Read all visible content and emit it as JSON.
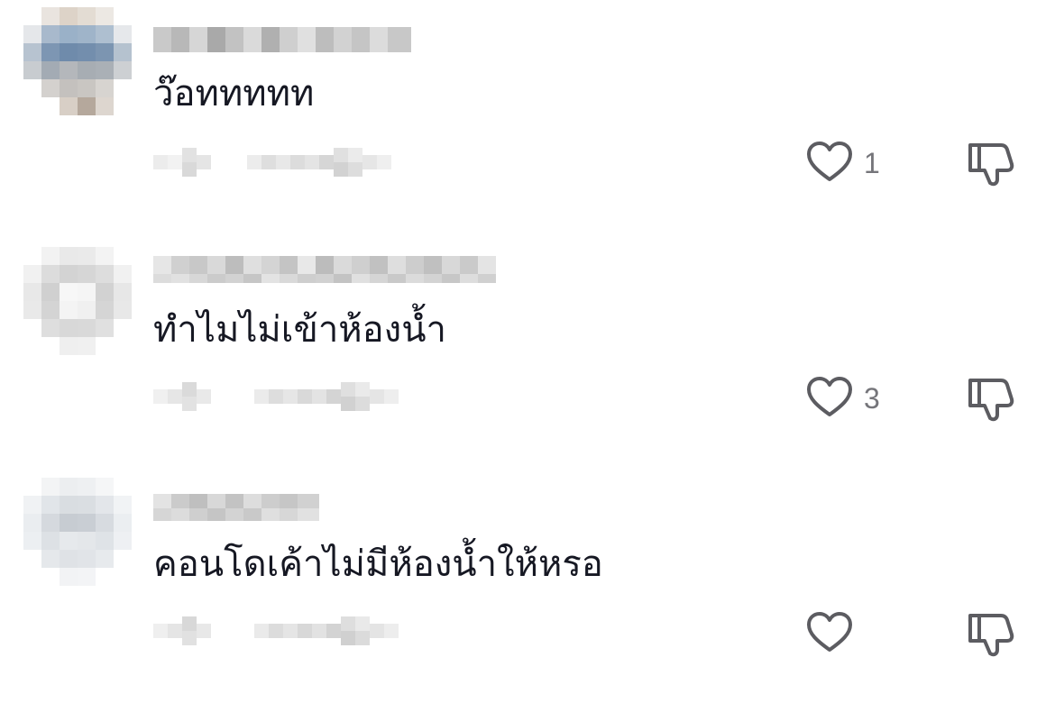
{
  "comments": [
    {
      "text": "ว๊อททททท",
      "like_count": "1"
    },
    {
      "text": "ทำไมไม่เข้าห้องน้ำ",
      "like_count": "3"
    },
    {
      "text": "คอนโดเค้าไม่มีห้องน้ำให้หรอ",
      "like_count": ""
    }
  ],
  "icons": {
    "like": "heart-outline-icon",
    "dislike": "thumbs-down-outline-icon"
  },
  "colors": {
    "text": "#161823",
    "icon": "#5c5c61",
    "count": "#75757a"
  }
}
